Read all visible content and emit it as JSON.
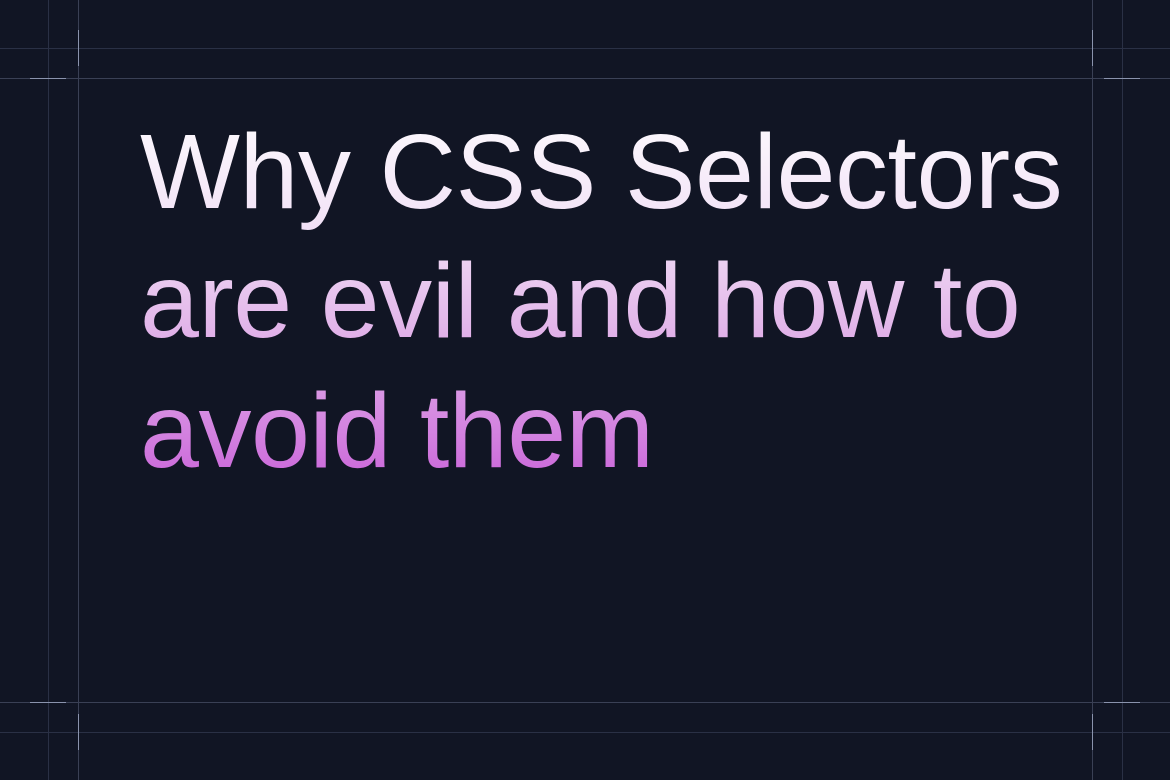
{
  "colors": {
    "background": "#111524",
    "guide": "#3a4055",
    "guide_faint": "#2a3045",
    "tick": "#8a93ad",
    "gradient_top": "#fdfbfe",
    "gradient_bottom": "#c85ed8"
  },
  "title": {
    "text": "Why CSS Selectors\nare evil and how to avoid them"
  }
}
